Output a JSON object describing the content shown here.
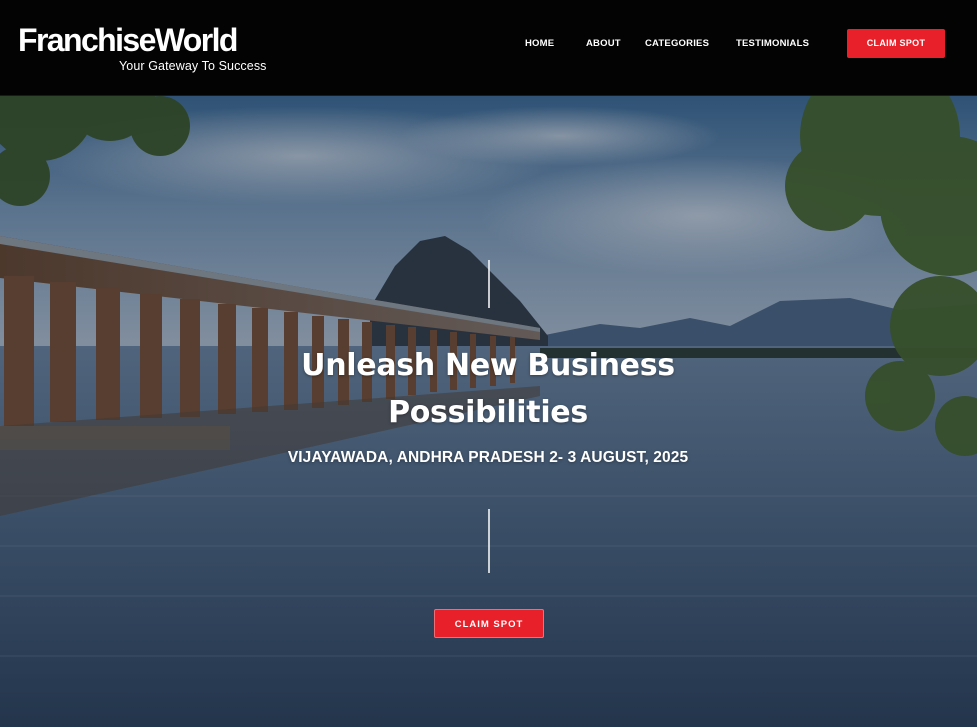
{
  "brand": {
    "name": "FranchiseWorld",
    "tagline": "Your Gateway To Success"
  },
  "nav": {
    "items": [
      {
        "label": "HOME"
      },
      {
        "label": "ABOUT"
      },
      {
        "label": "CATEGORIES"
      },
      {
        "label": "TESTIMONIALS"
      }
    ],
    "cta_label": "CLAIM SPOT"
  },
  "hero": {
    "title": "Unleash New Business Possibilities",
    "subtitle": "VIJAYAWADA, ANDHRA PRADESH 2- 3 AUGUST, 2025",
    "cta_label": "CLAIM SPOT",
    "background": "photo of a river with a long multi-arch barrage bridge, a rocky hill, distant mountains and tree foliage"
  },
  "colors": {
    "header_bg": "#030303",
    "accent_red": "#e8202a",
    "text_white": "#ffffff"
  }
}
